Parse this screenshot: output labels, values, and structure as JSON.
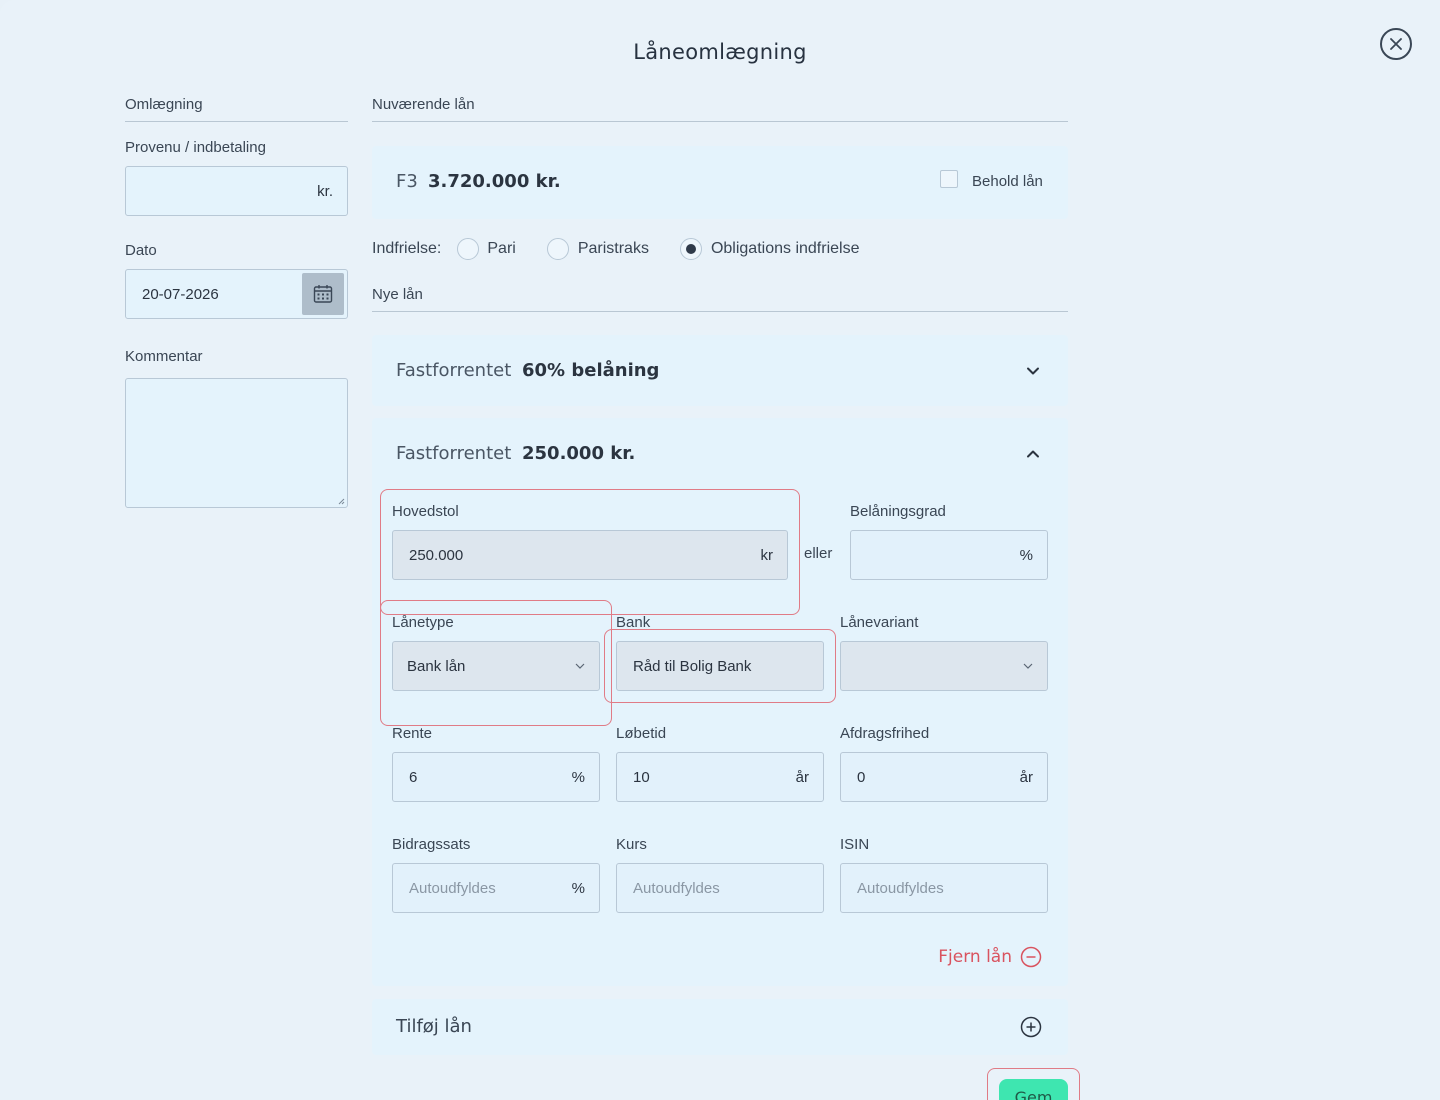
{
  "title": "Låneomlægning",
  "left": {
    "section": "Omlægning",
    "provenu_label": "Provenu / indbetaling",
    "provenu_value": "",
    "provenu_suffix": "kr.",
    "dato_label": "Dato",
    "dato_value": "20-07-2026",
    "kommentar_label": "Kommentar",
    "kommentar_value": ""
  },
  "current_loan": {
    "section": "Nuværende lån",
    "type": "F3",
    "amount": "3.720.000 kr.",
    "keep_label": "Behold lån",
    "keep_checked": false
  },
  "redemption": {
    "label": "Indfrielse:",
    "options": [
      "Pari",
      "Paristraks",
      "Obligations indfrielse"
    ],
    "selected": "Obligations indfrielse"
  },
  "new_loans": {
    "section": "Nye lån",
    "loan1": {
      "type": "Fastforrentet",
      "value": "60% belåning"
    },
    "loan2": {
      "type": "Fastforrentet",
      "value": "250.000 kr.",
      "hovedstol_label": "Hovedstol",
      "hovedstol_value": "250.000",
      "hovedstol_suffix": "kr",
      "eller": "eller",
      "belaaning_label": "Belåningsgrad",
      "belaaning_value": "",
      "belaaning_suffix": "%",
      "laanetype_label": "Lånetype",
      "laanetype_value": "Bank lån",
      "bank_label": "Bank",
      "bank_value": "Råd til Bolig Bank",
      "variant_label": "Lånevariant",
      "variant_value": "",
      "rente_label": "Rente",
      "rente_value": "6",
      "rente_suffix": "%",
      "loebetid_label": "Løbetid",
      "loebetid_value": "10",
      "loebetid_suffix": "år",
      "afdrag_label": "Afdragsfrihed",
      "afdrag_value": "0",
      "afdrag_suffix": "år",
      "bidrag_label": "Bidragssats",
      "bidrag_placeholder": "Autoudfyldes",
      "bidrag_suffix": "%",
      "kurs_label": "Kurs",
      "kurs_placeholder": "Autoudfyldes",
      "isin_label": "ISIN",
      "isin_placeholder": "Autoudfyldes",
      "remove_label": "Fjern lån"
    },
    "add_label": "Tilføj lån"
  },
  "save_label": "Gem",
  "colors": {
    "accent_save": "#3ee6b0",
    "remove": "#d9535f",
    "highlight": "#e07b86"
  }
}
